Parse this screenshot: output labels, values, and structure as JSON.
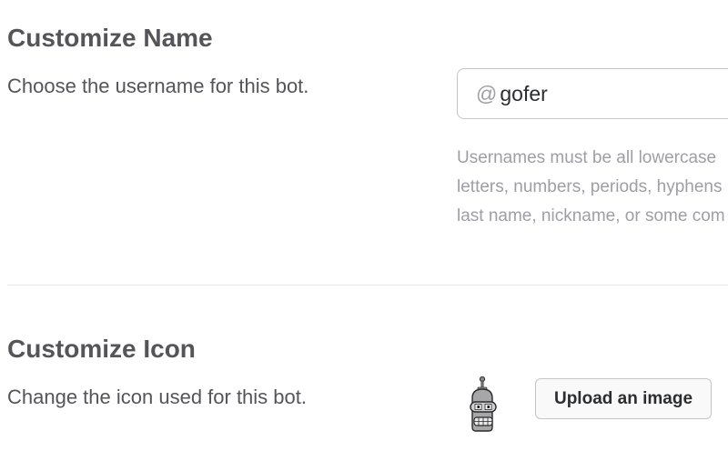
{
  "customize_name": {
    "title": "Customize Name",
    "description": "Choose the username for this bot.",
    "username_prefix": "@",
    "username_value": "gofer",
    "help_lines": [
      "Usernames must be all lowercase",
      "letters, numbers, periods, hyphens",
      "last name, nickname, or some com"
    ]
  },
  "customize_icon": {
    "title": "Customize Icon",
    "description": "Change the icon used for this bot.",
    "bot_icon": "robot-bender-icon",
    "upload_label": "Upload an image"
  },
  "colors": {
    "heading": "#555459",
    "muted": "#9e9ea6",
    "border": "#c5c5c5",
    "divider": "#e8e8e8"
  }
}
